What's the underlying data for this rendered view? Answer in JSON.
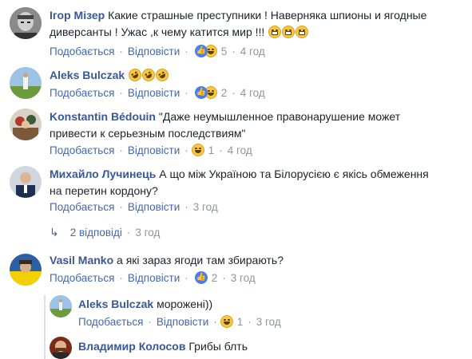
{
  "comments": [
    {
      "author": "Ігор Мізер",
      "text_line1": "Какие страшные преступники ! Наверняка шпионы и ягодные",
      "text_line2": "диверсанты ! Ужас ,к чему катится мир !!! ",
      "like": "Подобається",
      "reply": "Відповісти",
      "reactions": "5",
      "time": "4 год"
    },
    {
      "author": "Aleks Bulczak",
      "like": "Подобається",
      "reply": "Відповісти",
      "reactions": "2",
      "time": "4 год"
    },
    {
      "author": "Konstantin Bédouin",
      "text_line1": "\"Даже неумышленное правонарушение может",
      "text_line2": "привести к серьезным последствиям\"",
      "like": "Подобається",
      "reply": "Відповісти",
      "reactions": "1",
      "time": "4 год"
    },
    {
      "author": "Михайло Лучинець",
      "text_line1": "А що між Україною та Білорусією є якісь обмеження",
      "text_line2": "на перетин кордону?",
      "like": "Подобається",
      "reply": "Відповісти",
      "time": "3 год"
    },
    {
      "author": "Vasil Manko",
      "text_line1": "а які зараз ягоди там збирають?",
      "like": "Подобається",
      "reply": "Відповісти",
      "reactions": "2",
      "time": "3 год"
    }
  ],
  "replies_link": {
    "label": "2 відповіді",
    "time": "3 год"
  },
  "replies": [
    {
      "author": "Aleks Bulczak",
      "text": "морожені))",
      "like": "Подобається",
      "reply": "Відповісти",
      "reactions": "1",
      "time": "3 год"
    },
    {
      "author": "Владимир Колосов",
      "text": "Грибы блть"
    }
  ],
  "colors": {
    "link": "#4267b2",
    "author": "#385898",
    "meta": "#90949c",
    "text": "#1d2129"
  }
}
